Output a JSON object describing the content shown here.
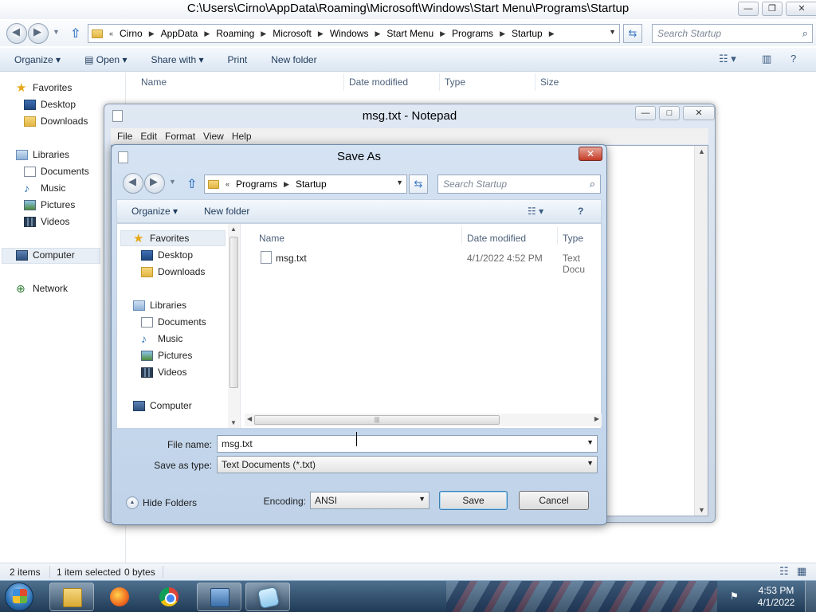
{
  "explorer": {
    "title": "C:\\Users\\Cirno\\AppData\\Roaming\\Microsoft\\Windows\\Start Menu\\Programs\\Startup",
    "breadcrumb": [
      "Cirno",
      "AppData",
      "Roaming",
      "Microsoft",
      "Windows",
      "Start Menu",
      "Programs",
      "Startup"
    ],
    "search_placeholder": "Search Startup",
    "toolbar": {
      "organize": "Organize",
      "open": "Open",
      "share_with": "Share with",
      "print": "Print",
      "new_folder": "New folder"
    },
    "nav": {
      "favorites": "Favorites",
      "desktop": "Desktop",
      "downloads": "Downloads",
      "libraries": "Libraries",
      "documents": "Documents",
      "music": "Music",
      "pictures": "Pictures",
      "videos": "Videos",
      "computer": "Computer",
      "network": "Network"
    },
    "columns": {
      "name": "Name",
      "date_modified": "Date modified",
      "type": "Type",
      "size": "Size"
    },
    "status": {
      "items": "2 items",
      "selected": "1 item selected",
      "size": "0 bytes"
    }
  },
  "notepad": {
    "title": "msg.txt - Notepad",
    "menu": [
      "File",
      "Edit",
      "Format",
      "View",
      "Help"
    ]
  },
  "save_as": {
    "title": "Save As",
    "breadcrumb": [
      "Programs",
      "Startup"
    ],
    "search_placeholder": "Search Startup",
    "toolbar": {
      "organize": "Organize",
      "new_folder": "New folder"
    },
    "nav": {
      "favorites": "Favorites",
      "desktop": "Desktop",
      "downloads": "Downloads",
      "libraries": "Libraries",
      "documents": "Documents",
      "music": "Music",
      "pictures": "Pictures",
      "videos": "Videos",
      "computer": "Computer"
    },
    "columns": {
      "name": "Name",
      "date_modified": "Date modified",
      "type": "Type"
    },
    "files": [
      {
        "name": "msg.txt",
        "date_modified": "4/1/2022 4:52 PM",
        "type": "Text Docu"
      }
    ],
    "file_name_label": "File name:",
    "file_name_value": "msg.txt",
    "save_as_type_label": "Save as type:",
    "save_as_type_value": "Text Documents (*.txt)",
    "hide_folders": "Hide Folders",
    "encoding_label": "Encoding:",
    "encoding_value": "ANSI",
    "save_button": "Save",
    "cancel_button": "Cancel"
  },
  "taskbar": {
    "clock_time": "4:53 PM",
    "clock_date": "4/1/2022",
    "apps": [
      "windows-explorer",
      "firefox",
      "chrome",
      "remote-desktop",
      "notepad"
    ]
  }
}
